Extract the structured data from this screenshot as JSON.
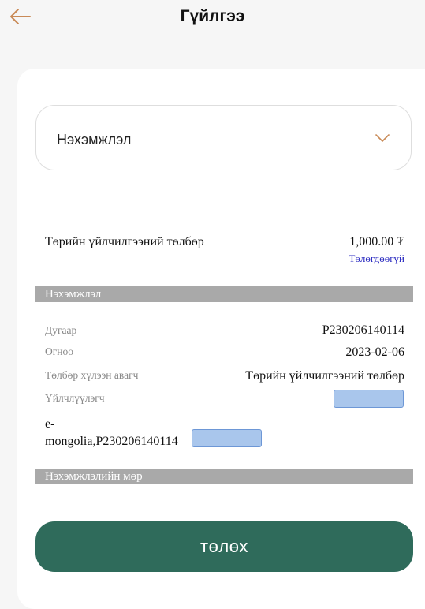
{
  "header": {
    "title": "Гүйлгээ",
    "back_icon": "arrow-left-icon"
  },
  "colors": {
    "accent": "#c98a57",
    "primary_button": "#2f6b5b",
    "section_bar": "#a9a9a9",
    "status_link": "#2a2ac0"
  },
  "invoice_select": {
    "value": "Нэхэмжлэл",
    "icon": "chevron-down-icon"
  },
  "fee": {
    "label": "Төрийн үйлчилгээний төлбөр",
    "amount": "1,000.00 ₮",
    "status": "Төлөгдөөгүй"
  },
  "invoice_section": {
    "title": "Нэхэмжлэл",
    "rows": [
      {
        "label": "Дугаар",
        "value": "P230206140114"
      },
      {
        "label": "Огноо",
        "value": "2023-02-06"
      },
      {
        "label": "Төлбөр хүлээн авагч",
        "value": "Төрийн үйлчилгээний төлбөр"
      },
      {
        "label": "Үйлчлүүлэгч",
        "value": ""
      }
    ],
    "reference_line1": "e-",
    "reference_line2": "mongolia,P230206140114"
  },
  "invoice_lines_section": {
    "title": "Нэхэмжлэлийн мөр"
  },
  "pay_button": {
    "label": "төлөх"
  }
}
